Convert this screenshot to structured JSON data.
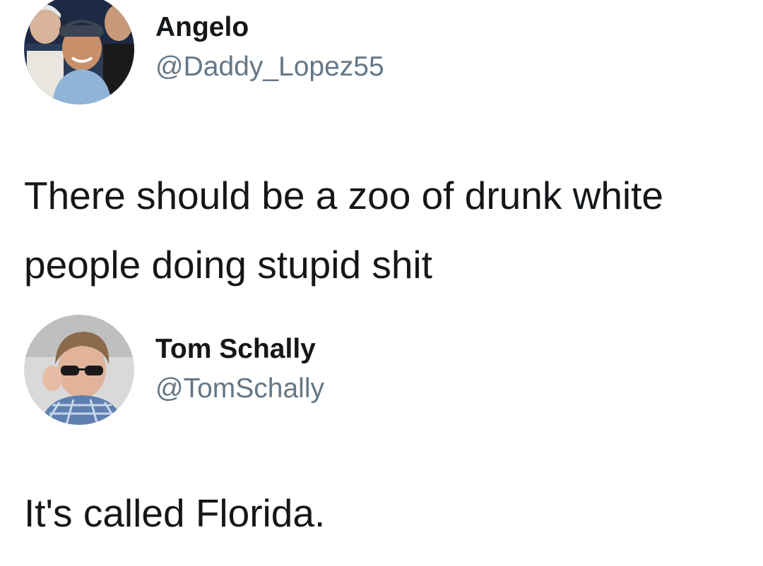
{
  "tweets": [
    {
      "name": "Angelo",
      "handle": "@Daddy_Lopez55",
      "lines": [
        "There should be a zoo of drunk white",
        "people doing stupid shit"
      ],
      "avatar_icon": "profile-photo-group"
    },
    {
      "name": "Tom Schally",
      "handle": "@TomSchally",
      "lines": [
        "It's called Florida."
      ],
      "avatar_icon": "profile-photo-sunglasses"
    }
  ],
  "colors": {
    "text": "#14171a",
    "handle": "#657786",
    "background": "#ffffff"
  }
}
